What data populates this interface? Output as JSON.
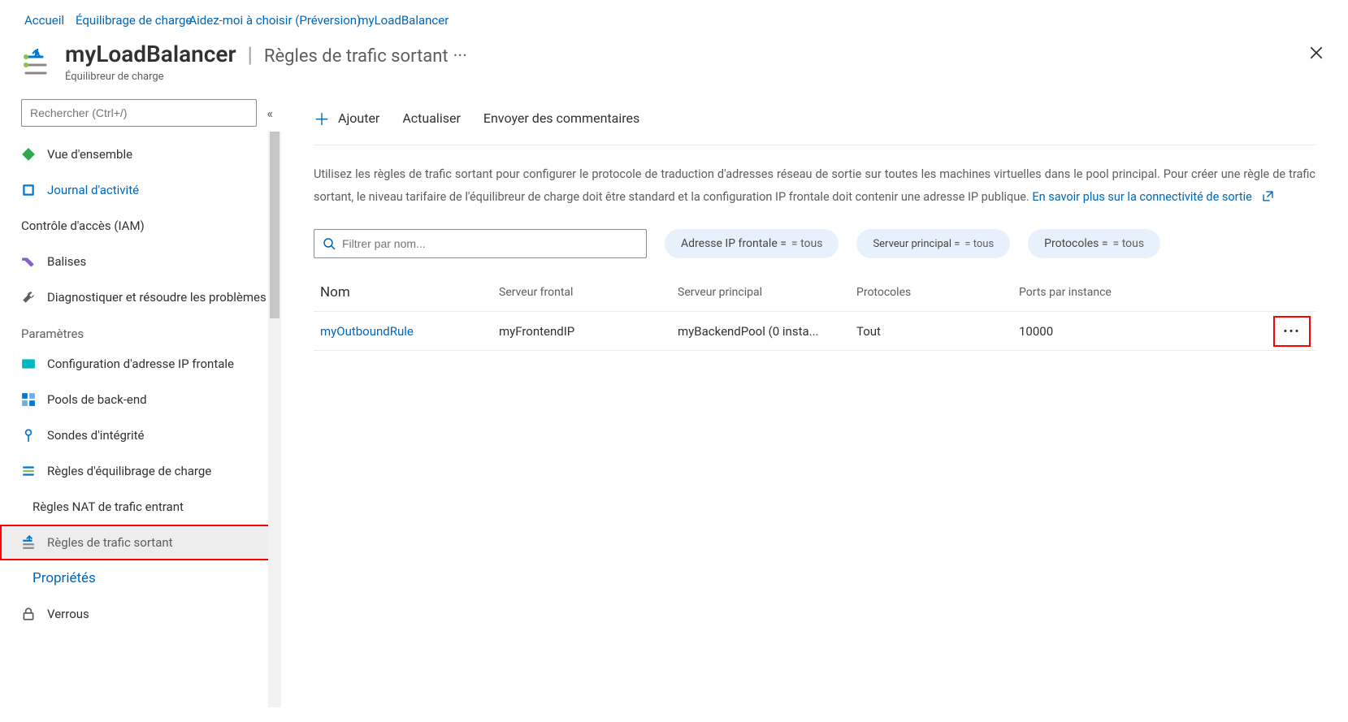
{
  "breadcrumb": {
    "home": "Accueil",
    "lb": "Équilibrage de charge",
    "help": "Aidez-moi à choisir (Préversion)",
    "resource": "myLoadBalancer"
  },
  "header": {
    "title": "myLoadBalancer",
    "section": "Règles de trafic sortant",
    "type": "Équilibreur de charge"
  },
  "sidebar": {
    "search_placeholder": "Rechercher (Ctrl+/)",
    "overview": "Vue d'ensemble",
    "activity_log": "Journal d'activité",
    "iam": "Contrôle d'accès (IAM)",
    "tags": "Balises",
    "diagnose": "Diagnostiquer et résoudre les problèmes",
    "section_settings": "Paramètres",
    "frontend_ip": "Configuration d'adresse IP frontale",
    "backend_pools": "Pools de back-end",
    "health_probes": "Sondes d'intégrité",
    "lb_rules": "Règles d'équilibrage de charge",
    "nat_rules": "Règles NAT de trafic entrant",
    "outbound_rules": "Règles de trafic sortant",
    "properties": "Propriétés",
    "locks": "Verrous"
  },
  "commands": {
    "add": "Ajouter",
    "refresh": "Actualiser",
    "feedback": "Envoyer des commentaires"
  },
  "info": {
    "line": "Utilisez les règles de trafic sortant pour configurer le protocole de traduction d'adresses réseau de sortie sur toutes les machines virtuelles dans le pool principal. Pour créer une règle de trafic sortant, le niveau tarifaire de l'équilibreur de charge doit être standard et la configuration IP frontale doit contenir une adresse IP publique.",
    "link": "En savoir plus sur la connectivité de sortie"
  },
  "filters": {
    "placeholder": "Filtrer par nom...",
    "frontend_label": "Adresse IP frontale =",
    "frontend_value": "= tous",
    "backend_label": "Serveur principal =",
    "backend_value": "= tous",
    "protocol_label": "Protocoles =",
    "protocol_value": "= tous"
  },
  "columns": {
    "name": "Nom",
    "frontend": "Serveur frontal",
    "backend": "Serveur principal",
    "protocols": "Protocoles",
    "ports": "Ports par instance"
  },
  "rows": [
    {
      "name": "myOutboundRule",
      "frontend": "myFrontendIP",
      "backend": "myBackendPool (0 insta...",
      "protocols": "Tout",
      "ports": "10000"
    }
  ]
}
